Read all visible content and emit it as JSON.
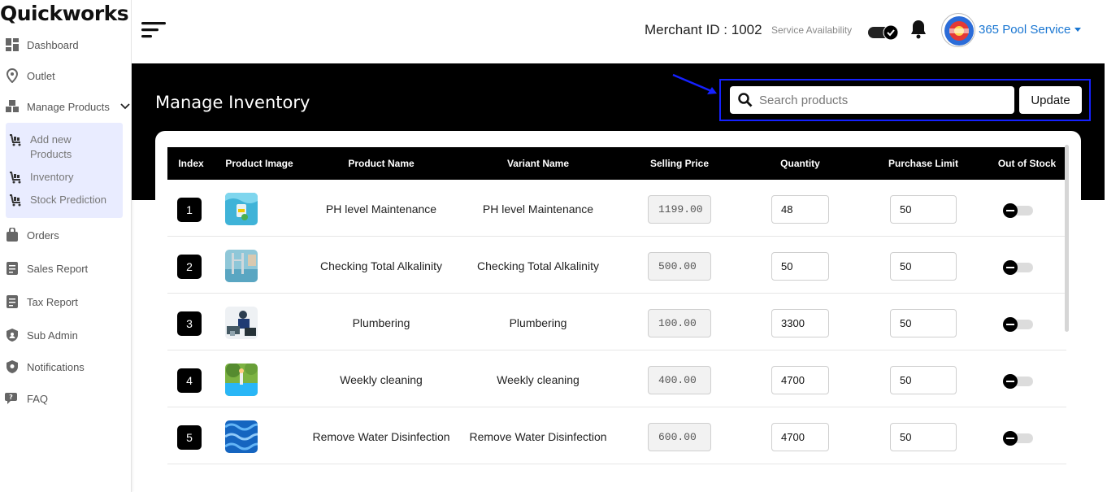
{
  "app": {
    "logo": "Quickworks"
  },
  "sidebar": {
    "items": [
      {
        "label": "Dashboard"
      },
      {
        "label": "Outlet"
      },
      {
        "label": "Manage Products"
      },
      {
        "label": "Orders"
      },
      {
        "label": "Sales Report"
      },
      {
        "label": "Tax Report"
      },
      {
        "label": "Sub Admin"
      },
      {
        "label": "Notifications"
      },
      {
        "label": "FAQ"
      }
    ],
    "submenu": [
      {
        "label": "Add new Products"
      },
      {
        "label": "Inventory"
      },
      {
        "label": "Stock Prediction"
      }
    ]
  },
  "header": {
    "merchant_id": "Merchant ID : 1002",
    "service_availability": "Service Availability",
    "user_name": "365 Pool Service"
  },
  "page": {
    "title": "Manage Inventory",
    "search_placeholder": "Search products",
    "update_label": "Update"
  },
  "table": {
    "headers": [
      "Index",
      "Product Image",
      "Product Name",
      "Variant Name",
      "Selling Price",
      "Quantity",
      "Purchase Limit",
      "Out of Stock"
    ],
    "rows": [
      {
        "index": "1",
        "name": "PH level Maintenance",
        "variant": "PH level Maintenance",
        "price": "1199.00",
        "quantity": "48",
        "limit": "50"
      },
      {
        "index": "2",
        "name": "Checking Total Alkalinity",
        "variant": "Checking Total Alkalinity",
        "price": "500.00",
        "quantity": "50",
        "limit": "50"
      },
      {
        "index": "3",
        "name": "Plumbering",
        "variant": "Plumbering",
        "price": "100.00",
        "quantity": "3300",
        "limit": "50"
      },
      {
        "index": "4",
        "name": "Weekly cleaning",
        "variant": "Weekly cleaning",
        "price": "400.00",
        "quantity": "4700",
        "limit": "50"
      },
      {
        "index": "5",
        "name": "Remove Water Disinfection",
        "variant": "Remove Water Disinfection",
        "price": "600.00",
        "quantity": "4700",
        "limit": "50"
      }
    ]
  },
  "colors": {
    "accent": "#1976d2",
    "highlight": "#1521ff",
    "submenu_bg": "#e9ecff"
  }
}
